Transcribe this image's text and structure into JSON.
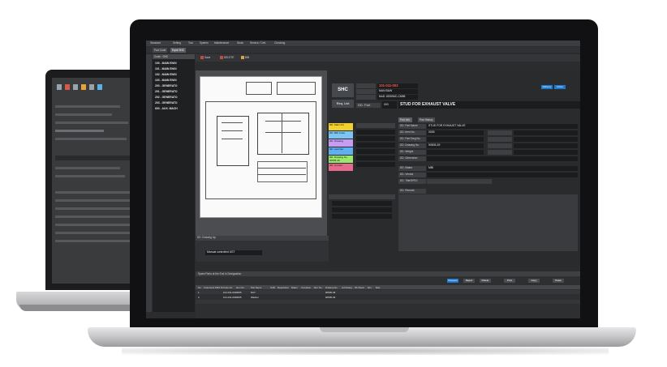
{
  "menubar": [
    "Standard",
    "Setting",
    "Tool",
    "System",
    "Maintenance",
    "Stock",
    "Service / Cert.",
    "Checking"
  ],
  "tabs": [
    {
      "label": "Part Code"
    },
    {
      "label": "Eqmt SHC",
      "active": true
    }
  ],
  "toolbar": {
    "buttons": [
      "Save",
      "DELETE",
      "BIB"
    ]
  },
  "sidebar": {
    "header": "Code - SHC",
    "items": [
      "100 - MAIN ENGI",
      "101 - MAIN ENGI",
      "102 - MAIN ENGI",
      "103 - MAIN ENGI",
      "200 - GENERATO",
      "201 - GENERATO",
      "202 - GENERATO",
      "203 - GENERATO",
      "600 - AUX. MACH"
    ]
  },
  "detail": {
    "shc_label": "SHC",
    "req_list_label": "Req. List",
    "code_no": "101-011-003",
    "maker_short": "MAN B&W",
    "make_code": "MoD: 6S50MC-C8/88",
    "part_label": "DD. Part",
    "part_prefix": "003",
    "part_name": "STUD FOR EXHAUST VALVE",
    "status_tabs": [
      "Part Info.",
      "Part History"
    ],
    "chips": [
      "DD. Mak Unit",
      "DD. Bklt Code",
      "DD. Drawing",
      "DD. Last Ser.",
      "DD. Drawing No.",
      "DD. Current"
    ],
    "chip_values": [
      "",
      "",
      "",
      "",
      "90505-39",
      ""
    ],
    "chip_colors": [
      "#f2d12e",
      "#7cc4f2",
      "#c69df2",
      "#5fb0f0",
      "#9ae86e",
      "#e56b8c"
    ],
    "info_rows": [
      {
        "label": "DD. Part Name",
        "value": "STUD FOR EXHAUST VALVE"
      },
      {
        "label": "DD. Item No.",
        "value": "0005"
      },
      {
        "label": "DD. Part Dwg No.",
        "value": ""
      },
      {
        "label": "DD. Drawing No.",
        "value": "90505-39"
      },
      {
        "label": "DD. Weight",
        "value": ""
      },
      {
        "label": "DD. Dimension",
        "value": ""
      },
      {
        "label": "DD. Maker",
        "value": "MBI"
      },
      {
        "label": "DD. Vendor",
        "value": ""
      },
      {
        "label": "DD. Title/SPEC",
        "value": ""
      },
      {
        "label": "DD. Remark",
        "value": ""
      }
    ],
    "buttons": [
      "Delivery",
      "Active"
    ]
  },
  "bottom": {
    "title": "Spare Parts at the End in Designation",
    "columns": [
      "No",
      "Code",
      "Input",
      "PMS ID",
      "Code No.",
      "Item No.",
      "Part Name",
      "SUB",
      "Requisition",
      "Maker",
      "Complete",
      "Ref. No.",
      "Drawing No.",
      "Job Dateg",
      "Wt./Stock",
      "Min.",
      "Max."
    ],
    "rows": [
      [
        "1",
        "",
        "",
        "",
        "101-011-001",
        "0005",
        "NUT",
        "",
        "",
        "",
        "",
        "",
        "90505-39",
        "",
        "",
        "",
        ""
      ],
      [
        "2",
        "",
        "",
        "",
        "101-011-002",
        "0005",
        "Washer",
        "",
        "",
        "",
        "",
        "",
        "90505-39",
        "",
        "",
        "",
        ""
      ]
    ],
    "buttons": [
      "Request",
      "Reject",
      "Delete",
      "Print",
      "Copy",
      "Paste"
    ]
  },
  "ebom": {
    "title": "DD. Drawing Up",
    "value": "Manual controlled UST"
  }
}
